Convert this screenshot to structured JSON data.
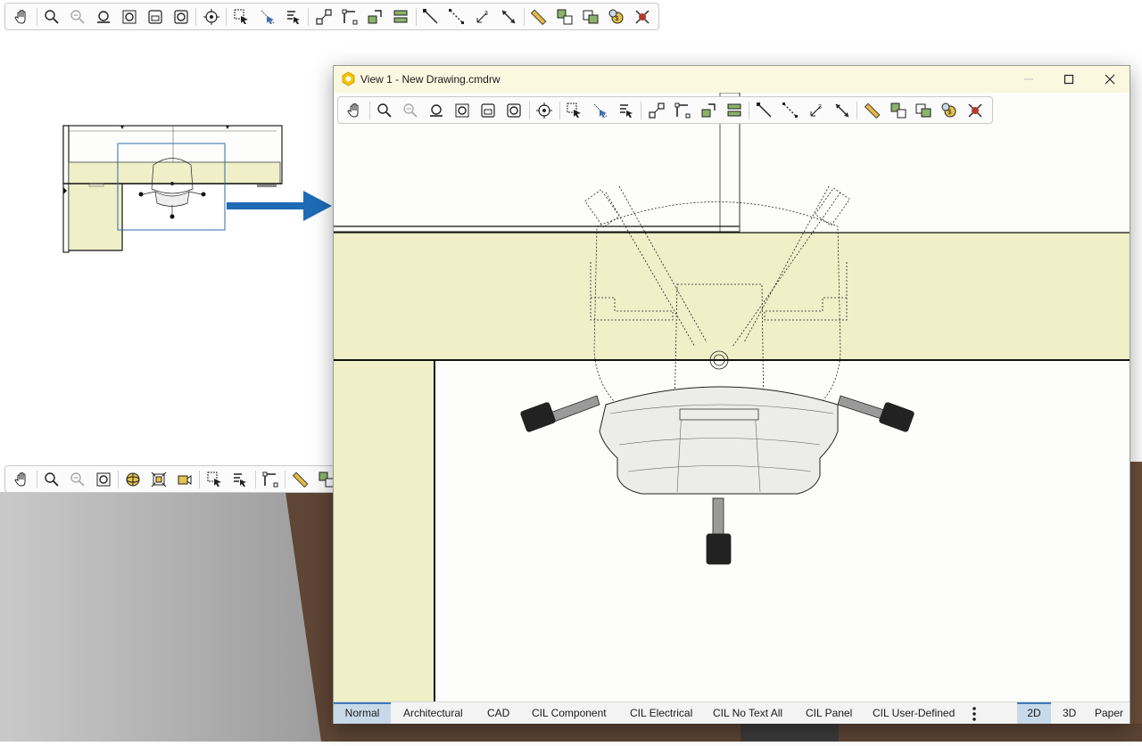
{
  "window": {
    "title": "View 1 - New Drawing.cmdrw"
  },
  "toolbar_icons": {
    "top": [
      "pan-icon",
      "zoom-icon",
      "zoom-out-icon",
      "zoom-window-icon",
      "zoom-fit-icon",
      "zoom-selected-icon",
      "zoom-previous-icon",
      "center-view-icon",
      "select-icon",
      "select-all-icon",
      "select-text-icon",
      "connect-icon",
      "corner-icon",
      "move-icon",
      "stack-icon",
      "line-icon",
      "dashed-line-icon",
      "dimension-icon",
      "measure-icon",
      "ruler-icon",
      "copy-icon",
      "paste-icon",
      "price-icon",
      "delete-icon"
    ],
    "lower": [
      "pan-icon",
      "zoom-icon",
      "zoom-out-icon",
      "zoom-fit-icon",
      "orbit-icon",
      "fit-3d-icon",
      "camera-icon",
      "select-icon",
      "select-text-icon",
      "corner-icon",
      "ruler-icon",
      "copy-icon"
    ]
  },
  "status_bar": {
    "layers": [
      "Normal",
      "Architectural",
      "CAD",
      "CIL Component",
      "CIL Electrical",
      "CIL No Text All",
      "CIL Panel",
      "CIL User-Defined"
    ],
    "active_layer": "Normal",
    "views": [
      "2D",
      "3D",
      "Paper"
    ],
    "active_view": "2D"
  },
  "colors": {
    "work_surface": "#efefc8",
    "selection_rect": "#2e6ba8",
    "arrow": "#1e6bb5",
    "titlebar": "#fbf8e0"
  }
}
